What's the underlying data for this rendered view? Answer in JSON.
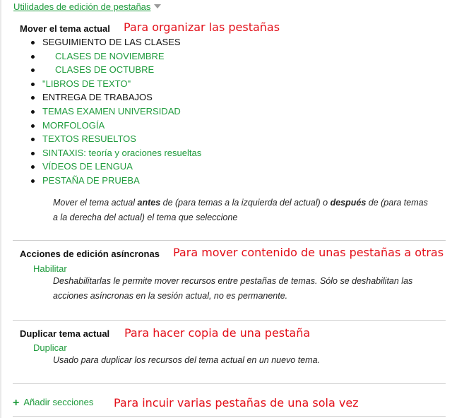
{
  "header": {
    "title": "Utilidades de edición de pestañas"
  },
  "move_section": {
    "heading": "Mover el tema actual",
    "note": "Para organizar las pestañas",
    "topics": [
      {
        "label": "SEGUIMIENTO DE LAS CLASES"
      },
      {
        "label": "CLASES DE NOVIEMBRE"
      },
      {
        "label": "CLASES DE OCTUBRE"
      },
      {
        "label": "\"LIBROS DE TEXTO\""
      },
      {
        "label": "ENTREGA DE TRABAJOS"
      },
      {
        "label": "TEMAS EXAMEN UNIVERSIDAD"
      },
      {
        "label": "MORFOLOGÍA"
      },
      {
        "label": "TEXTOS RESUELTOS"
      },
      {
        "label": "SINTAXIS: teoría y oraciones resueltas"
      },
      {
        "label": "VÍDEOS DE LENGUA"
      },
      {
        "label": "PESTAÑA DE PRUEBA"
      }
    ],
    "desc_part1": "Mover el tema actual ",
    "desc_antes": "antes",
    "desc_part2": " de (para temas a la izquierda del actual) o ",
    "desc_despues": "después",
    "desc_part3": " de (para temas a la derecha del actual) el tema que seleccione"
  },
  "async_section": {
    "heading": "Acciones de edición asíncronas",
    "note": "Para mover contenido de unas pestañas a otras",
    "link": "Habilitar",
    "desc": "Deshabilitarlas le permite mover recursos entre pestañas de temas. Sólo se deshabilitan las acciones asíncronas en la sesión actual, no es permanente."
  },
  "duplicate_section": {
    "heading": "Duplicar tema actual",
    "note": "Para hacer copia de una pestaña",
    "link": "Duplicar",
    "desc": "Usado para duplicar los recursos del tema actual en un nuevo tema."
  },
  "add_section": {
    "link": "Añadir secciones",
    "note": "Para incuir varias pestañas de una sola vez"
  }
}
